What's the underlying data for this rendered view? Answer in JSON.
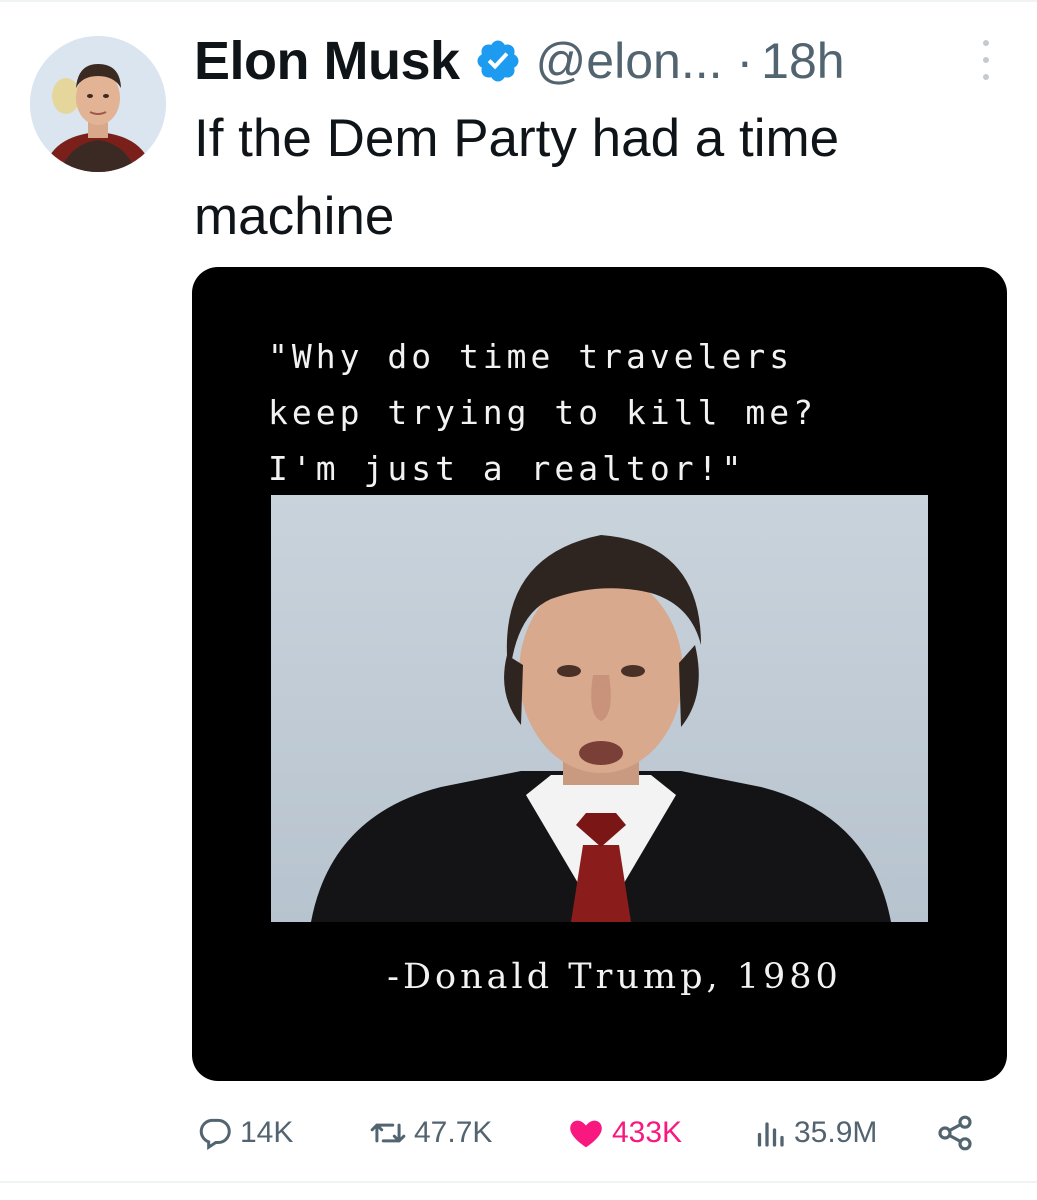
{
  "tweet": {
    "author_name": "Elon Musk",
    "handle": "@elon...",
    "separator": "·",
    "time": "18h",
    "text": "If the Dem Party had a time machine"
  },
  "media": {
    "quote": "\"Why do time travelers\nkeep trying to kill me?\nI'm just a realtor!\"",
    "attribution": "-Donald Trump, 1980"
  },
  "actions": {
    "replies": "14K",
    "reposts": "47.7K",
    "likes": "433K",
    "views": "35.9M"
  },
  "icons": {
    "verified": "verified-badge-icon",
    "more": "more-options-icon",
    "reply": "reply-icon",
    "repost": "repost-icon",
    "like": "heart-icon",
    "views": "views-icon",
    "share": "share-icon"
  },
  "colors": {
    "verified": "#1d9bf0",
    "like_active": "#f91880",
    "secondary_text": "#536471",
    "primary_text": "#0f1419"
  }
}
